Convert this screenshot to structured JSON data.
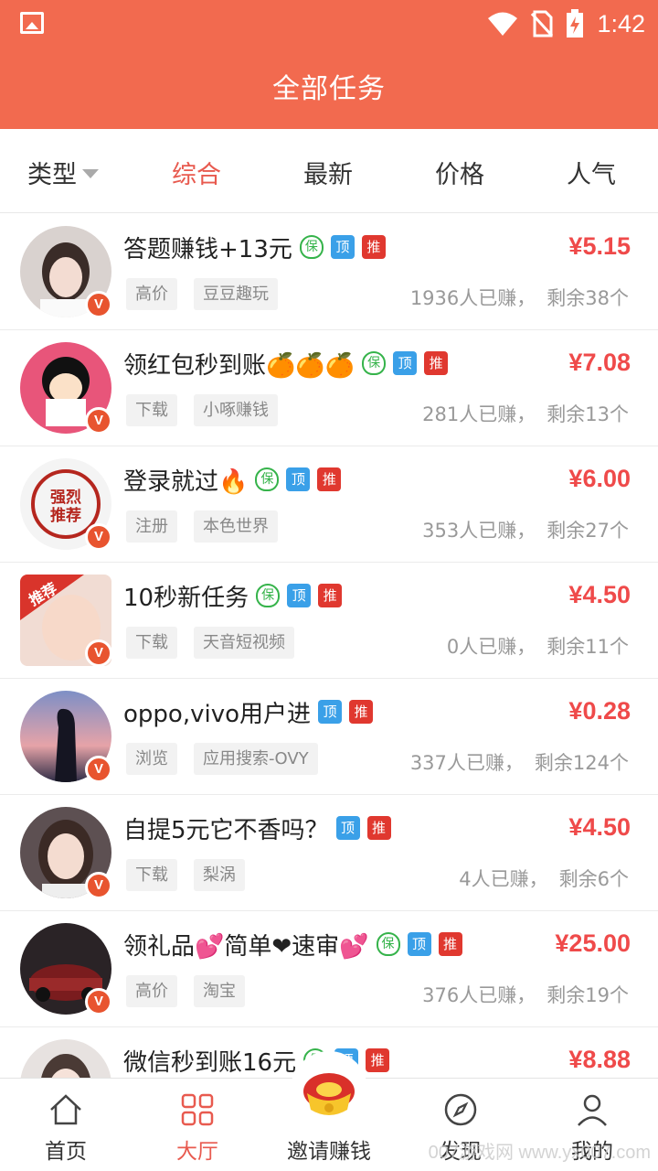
{
  "status_bar": {
    "time": "1:42"
  },
  "header": {
    "title": "全部任务"
  },
  "filters": {
    "type_label": "类型",
    "tabs": [
      "综合",
      "最新",
      "价格",
      "人气"
    ]
  },
  "tasks": [
    {
      "title": "答题赚钱+13元",
      "badges": [
        "保",
        "顶",
        "推"
      ],
      "price": "¥5.15",
      "tags": [
        "高价",
        "豆豆趣玩"
      ],
      "earned": "1936人已赚，",
      "remaining": "剩余38个"
    },
    {
      "title": "领红包秒到账🍊🍊🍊",
      "badges": [
        "保",
        "顶",
        "推"
      ],
      "price": "¥7.08",
      "tags": [
        "下载",
        "小啄赚钱"
      ],
      "earned": "281人已赚，",
      "remaining": "剩余13个"
    },
    {
      "title": "登录就过🔥",
      "badges": [
        "保",
        "顶",
        "推"
      ],
      "price": "¥6.00",
      "tags": [
        "注册",
        "本色世界"
      ],
      "earned": "353人已赚，",
      "remaining": "剩余27个"
    },
    {
      "title": "10秒新任务",
      "badges": [
        "保",
        "顶",
        "推"
      ],
      "price": "¥4.50",
      "tags": [
        "下载",
        "天音短视频"
      ],
      "earned": "0人已赚，",
      "remaining": "剩余11个"
    },
    {
      "title": "oppo,vivo用户进",
      "badges": [
        "顶",
        "推"
      ],
      "price": "¥0.28",
      "tags": [
        "浏览",
        "应用搜索-OVY"
      ],
      "earned": "337人已赚，",
      "remaining": "剩余124个"
    },
    {
      "title": "自提5元它不香吗？",
      "badges": [
        "顶",
        "推"
      ],
      "price": "¥4.50",
      "tags": [
        "下载",
        "梨涡"
      ],
      "earned": "4人已赚，",
      "remaining": "剩余6个"
    },
    {
      "title": "领礼品💕简单❤速审💕",
      "badges": [
        "保",
        "顶",
        "推"
      ],
      "price": "¥25.00",
      "tags": [
        "高价",
        "淘宝"
      ],
      "earned": "376人已赚，",
      "remaining": "剩余19个"
    },
    {
      "title": "微信秒到账16元",
      "badges": [
        "保",
        "顶",
        "推"
      ],
      "price": "¥8.88",
      "tags": [],
      "earned": "",
      "remaining": ""
    }
  ],
  "avatar_stamp_text": [
    "强烈",
    "推荐"
  ],
  "avatar_ribbon_text": "推荐",
  "vip_badge": "V",
  "bottom_nav": {
    "items": [
      {
        "label": "首页",
        "icon": "home-icon"
      },
      {
        "label": "大厅",
        "icon": "grid-icon"
      },
      {
        "label": "邀请赚钱",
        "icon": "gold-ingot-icon"
      },
      {
        "label": "发现",
        "icon": "compass-icon"
      },
      {
        "label": "我的",
        "icon": "user-icon"
      }
    ]
  },
  "watermark": "007游戏网 www.yx007.com",
  "colors": {
    "header": "#f26a4f",
    "accent": "#e85a4f",
    "price": "#ef4a4a",
    "badge_ding": "#3aa0e8",
    "badge_tui": "#e0382f",
    "badge_bao": "#35b34a"
  }
}
